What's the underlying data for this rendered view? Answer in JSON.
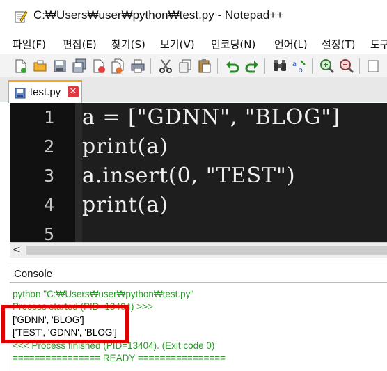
{
  "window": {
    "title": "C:₩Users₩user₩python₩test.py - Notepad++"
  },
  "menu": {
    "items": [
      "파일(F)",
      "편집(E)",
      "찾기(S)",
      "보기(V)",
      "인코딩(N)",
      "언어(L)",
      "설정(T)",
      "도구"
    ]
  },
  "toolbar": {
    "icons": [
      "new-file-icon",
      "open-file-icon",
      "save-icon",
      "save-all-icon",
      "close-icon",
      "close-all-icon",
      "print-icon",
      "cut-icon",
      "copy-icon",
      "paste-icon",
      "undo-icon",
      "redo-icon",
      "find-icon",
      "replace-icon",
      "zoom-in-icon",
      "zoom-out-icon"
    ]
  },
  "tab": {
    "label": "test.py",
    "close": "✕"
  },
  "editor": {
    "line_numbers": [
      "1",
      "2",
      "3",
      "4",
      "5"
    ],
    "lines": [
      "a = [\"GDNN\", \"BLOG\"]",
      "print(a)",
      "a.insert(0, \"TEST\")",
      "print(a)",
      ""
    ]
  },
  "scrollbar": {
    "left_arrow": "<"
  },
  "console": {
    "title": "Console",
    "lines": [
      "python \"C:₩Users₩user₩python₩test.py\"",
      "Process started (PID=13404) >>>",
      "['GDNN', 'BLOG']",
      "['TEST', 'GDNN', 'BLOG']",
      "<<< Process finished (PID=13404). (Exit code 0)",
      "================ READY ================"
    ]
  },
  "colors": {
    "editor_bg": "#1e1e1e",
    "console_green": "#2a9a2a",
    "highlight": "#e00000",
    "tab_accent": "#f7a71d"
  }
}
